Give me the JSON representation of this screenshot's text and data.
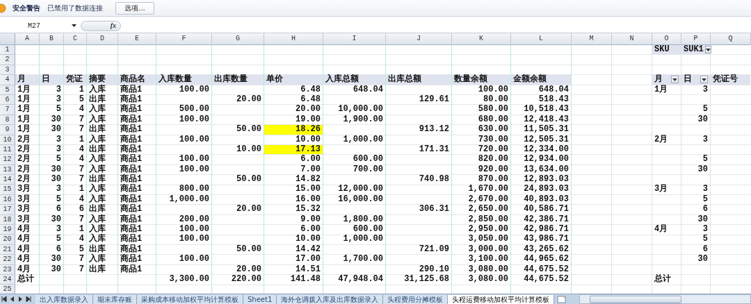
{
  "message_bar": {
    "title": "安全警告",
    "message": "已禁用了数据连接",
    "button": "选项..."
  },
  "formula_bar": {
    "name_box": "M27",
    "function_label": "fx"
  },
  "table": {
    "columns": [
      "A",
      "B",
      "C",
      "D",
      "E",
      "F",
      "G",
      "H",
      "I",
      "J",
      "K",
      "L",
      "M",
      "N",
      "O",
      "P",
      "Q"
    ],
    "rows": [
      {
        "number": "1",
        "kind": "filter",
        "cells": {
          "O": "SKU",
          "P": "SUK1"
        },
        "dropdowns": {
          "P": true
        }
      },
      {
        "number": "2",
        "kind": "blank"
      },
      {
        "number": "3",
        "kind": "blank"
      },
      {
        "number": "4",
        "kind": "header",
        "cells": {
          "A": "月",
          "B": "日",
          "C": "凭证",
          "D": "摘要",
          "E": "商品名",
          "F": "入库数量",
          "G": "出库数量",
          "H": "单价",
          "I": "入库总额",
          "J": "出库总额",
          "K": "数量余额",
          "L": "金额余额",
          "O": "月",
          "P": "日",
          "Q": "凭证号"
        },
        "dropdowns": {
          "O": true,
          "P": true
        }
      },
      {
        "number": "5",
        "kind": "data",
        "cells": {
          "A": "1月",
          "B": "3",
          "C": "1",
          "D": "入库",
          "E": "商品1",
          "F": "100.00",
          "H": "6.48",
          "I": "648.04",
          "K": "100.00",
          "L": "648.04",
          "O": "1月",
          "P": "3"
        }
      },
      {
        "number": "6",
        "kind": "data",
        "cells": {
          "A": "1月",
          "B": "3",
          "C": "5",
          "D": "出库",
          "E": "商品1",
          "G": "20.00",
          "H": "6.48",
          "J": "129.61",
          "K": "80.00",
          "L": "518.43"
        }
      },
      {
        "number": "7",
        "kind": "data",
        "cells": {
          "A": "1月",
          "B": "5",
          "C": "4",
          "D": "入库",
          "E": "商品1",
          "F": "500.00",
          "H": "20.00",
          "I": "10,000.00",
          "K": "580.00",
          "L": "10,518.43",
          "P": "5"
        }
      },
      {
        "number": "8",
        "kind": "data",
        "cells": {
          "A": "1月",
          "B": "30",
          "C": "7",
          "D": "入库",
          "E": "商品1",
          "F": "100.00",
          "H": "19.00",
          "I": "1,900.00",
          "K": "680.00",
          "L": "12,418.43",
          "P": "30"
        }
      },
      {
        "number": "9",
        "kind": "data",
        "cells": {
          "A": "1月",
          "B": "30",
          "C": "7",
          "D": "出库",
          "E": "商品1",
          "G": "50.00",
          "H": "18.26",
          "J": "913.12",
          "K": "630.00",
          "L": "11,505.31"
        },
        "highlights": {
          "H": true
        }
      },
      {
        "number": "10",
        "kind": "data",
        "cells": {
          "A": "2月",
          "B": "3",
          "C": "1",
          "D": "入库",
          "E": "商品1",
          "F": "100.00",
          "H": "10.00",
          "I": "1,000.00",
          "K": "730.00",
          "L": "12,505.31",
          "O": "2月",
          "P": "3"
        }
      },
      {
        "number": "11",
        "kind": "data",
        "cells": {
          "A": "2月",
          "B": "3",
          "C": "4",
          "D": "出库",
          "E": "商品1",
          "G": "10.00",
          "H": "17.13",
          "J": "171.31",
          "K": "720.00",
          "L": "12,334.00"
        },
        "highlights": {
          "H": true
        }
      },
      {
        "number": "12",
        "kind": "data",
        "cells": {
          "A": "2月",
          "B": "5",
          "C": "4",
          "D": "入库",
          "E": "商品1",
          "F": "100.00",
          "H": "6.00",
          "I": "600.00",
          "K": "820.00",
          "L": "12,934.00",
          "P": "5"
        }
      },
      {
        "number": "13",
        "kind": "data",
        "cells": {
          "A": "2月",
          "B": "30",
          "C": "7",
          "D": "入库",
          "E": "商品1",
          "F": "100.00",
          "H": "7.00",
          "I": "700.00",
          "K": "920.00",
          "L": "13,634.00",
          "P": "30"
        }
      },
      {
        "number": "14",
        "kind": "data",
        "cells": {
          "A": "2月",
          "B": "30",
          "C": "7",
          "D": "出库",
          "E": "商品1",
          "G": "50.00",
          "H": "14.82",
          "J": "740.98",
          "K": "870.00",
          "L": "12,893.03"
        }
      },
      {
        "number": "15",
        "kind": "data",
        "cells": {
          "A": "3月",
          "B": "3",
          "C": "1",
          "D": "入库",
          "E": "商品1",
          "F": "800.00",
          "H": "15.00",
          "I": "12,000.00",
          "K": "1,670.00",
          "L": "24,893.03",
          "O": "3月",
          "P": "3"
        }
      },
      {
        "number": "16",
        "kind": "data",
        "cells": {
          "A": "3月",
          "B": "5",
          "C": "4",
          "D": "入库",
          "E": "商品1",
          "F": "1,000.00",
          "H": "16.00",
          "I": "16,000.00",
          "K": "2,670.00",
          "L": "40,893.03",
          "P": "5"
        }
      },
      {
        "number": "17",
        "kind": "data",
        "cells": {
          "A": "3月",
          "B": "6",
          "C": "6",
          "D": "出库",
          "E": "商品1",
          "G": "20.00",
          "H": "15.32",
          "J": "306.31",
          "K": "2,650.00",
          "L": "40,586.71",
          "P": "6"
        }
      },
      {
        "number": "18",
        "kind": "data",
        "cells": {
          "A": "3月",
          "B": "30",
          "C": "7",
          "D": "入库",
          "E": "商品1",
          "F": "200.00",
          "H": "9.00",
          "I": "1,800.00",
          "K": "2,850.00",
          "L": "42,386.71",
          "P": "30"
        }
      },
      {
        "number": "19",
        "kind": "data",
        "cells": {
          "A": "4月",
          "B": "3",
          "C": "1",
          "D": "入库",
          "E": "商品1",
          "F": "100.00",
          "H": "6.00",
          "I": "600.00",
          "K": "2,950.00",
          "L": "42,986.71",
          "O": "4月",
          "P": "3"
        }
      },
      {
        "number": "20",
        "kind": "data",
        "cells": {
          "A": "4月",
          "B": "5",
          "C": "4",
          "D": "入库",
          "E": "商品1",
          "F": "100.00",
          "H": "10.00",
          "I": "1,000.00",
          "K": "3,050.00",
          "L": "43,986.71",
          "P": "5"
        }
      },
      {
        "number": "21",
        "kind": "data",
        "cells": {
          "A": "4月",
          "B": "6",
          "C": "5",
          "D": "出库",
          "E": "商品1",
          "G": "50.00",
          "H": "14.42",
          "J": "721.09",
          "K": "3,000.00",
          "L": "43,265.62",
          "P": "6"
        }
      },
      {
        "number": "22",
        "kind": "data",
        "cells": {
          "A": "4月",
          "B": "30",
          "C": "7",
          "D": "入库",
          "E": "商品1",
          "F": "100.00",
          "H": "17.00",
          "I": "1,700.00",
          "K": "3,100.00",
          "L": "44,965.62",
          "P": "30"
        }
      },
      {
        "number": "23",
        "kind": "data",
        "cells": {
          "A": "4月",
          "B": "30",
          "C": "7",
          "D": "出库",
          "E": "商品1",
          "G": "20.00",
          "H": "14.51",
          "J": "290.10",
          "K": "3,080.00",
          "L": "44,675.52"
        }
      },
      {
        "number": "24",
        "kind": "total",
        "cells": {
          "A": "总计",
          "F": "3,300.00",
          "G": "220.00",
          "H": "141.48",
          "I": "47,948.04",
          "J": "31,125.68",
          "K": "3,080.00",
          "L": "44,675.52",
          "O": "总计"
        }
      },
      {
        "number": "25",
        "kind": "blank"
      }
    ]
  },
  "sheet_tabs": [
    {
      "label": "出入库数据录入",
      "selected": false
    },
    {
      "label": "期末库存账",
      "selected": false
    },
    {
      "label": "采购成本移动加权平均计算模板",
      "selected": false
    },
    {
      "label": "Sheet1",
      "selected": false
    },
    {
      "label": "海外仓调拨入库及出库数据录入",
      "selected": false
    },
    {
      "label": "头程费用分摊模板",
      "selected": false
    },
    {
      "label": "头程运费移动加权平均计算模板",
      "selected": true
    }
  ]
}
